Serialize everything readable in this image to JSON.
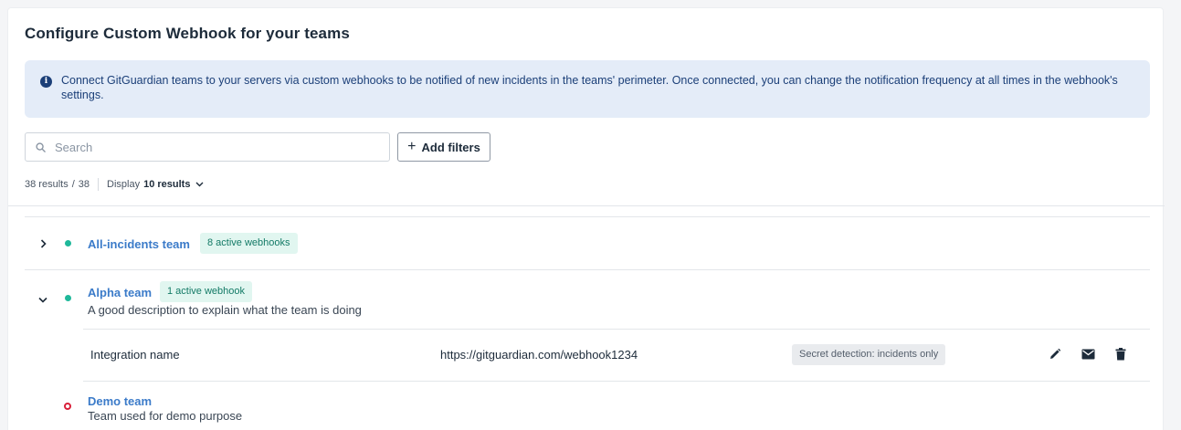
{
  "page": {
    "title": "Configure Custom Webhook for your teams"
  },
  "info_banner": {
    "icon": "info-icon",
    "text": "Connect GitGuardian teams to your servers via custom webhooks to be notified of new incidents in the teams' perimeter. Once connected, you can change the notification frequency at all times in the webhook's settings."
  },
  "toolbar": {
    "search_placeholder": "Search",
    "search_value": "",
    "add_filters_label": "Add filters"
  },
  "results": {
    "count_label": "38 results",
    "separator": "/",
    "total": "38",
    "display_label": "Display",
    "display_value": "10 results"
  },
  "teams": [
    {
      "name": "All-incidents team",
      "status": "active",
      "badge": "8 active webhooks",
      "expanded": false
    },
    {
      "name": "Alpha team",
      "status": "active",
      "badge": "1 active webhook",
      "description": "A good description to explain what the team is doing",
      "expanded": true,
      "webhooks": [
        {
          "integration_name": "Integration name",
          "url": "https://gitguardian.com/webhook1234",
          "scope": "Secret detection: incidents only"
        }
      ]
    },
    {
      "name": "Demo team",
      "status": "inactive",
      "description": "Team used for demo purpose"
    }
  ],
  "colors": {
    "accent_link": "#3b7bc9",
    "active_dot": "#1fb89a",
    "inactive_dot": "#d9203a",
    "banner_bg": "#e4ecf8",
    "badge_bg": "#e1f6f0"
  }
}
